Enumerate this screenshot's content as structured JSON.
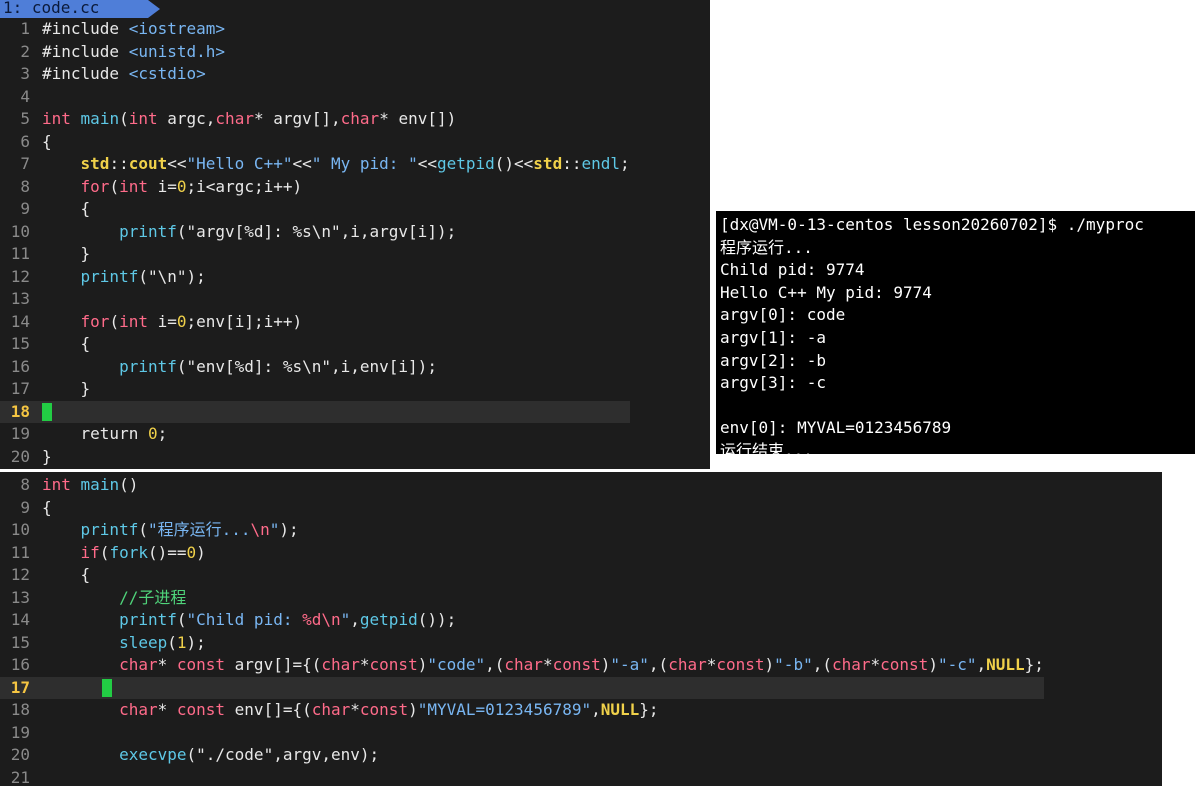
{
  "top_editor": {
    "tab_label": "1: code.cc",
    "cursor_line": 18,
    "lines": [
      {
        "n": "1",
        "tokens": [
          [
            "pp",
            "#include "
          ],
          [
            "inc",
            "<iostream>"
          ]
        ]
      },
      {
        "n": "2",
        "tokens": [
          [
            "pp",
            "#include "
          ],
          [
            "inc",
            "<unistd.h>"
          ]
        ]
      },
      {
        "n": "3",
        "tokens": [
          [
            "pp",
            "#include "
          ],
          [
            "inc",
            "<cstdio>"
          ]
        ]
      },
      {
        "n": "4",
        "tokens": []
      },
      {
        "n": "5",
        "tokens": [
          [
            "kw",
            "int"
          ],
          [
            "plain",
            " "
          ],
          [
            "fn",
            "main"
          ],
          [
            "plain",
            "("
          ],
          [
            "kw",
            "int"
          ],
          [
            "plain",
            " argc,"
          ],
          [
            "kw",
            "char"
          ],
          [
            "plain",
            "* argv[],"
          ],
          [
            "kw",
            "char"
          ],
          [
            "plain",
            "* env[])"
          ]
        ]
      },
      {
        "n": "6",
        "tokens": [
          [
            "plain",
            "{"
          ]
        ]
      },
      {
        "n": "7",
        "tokens": [
          [
            "plain",
            "    "
          ],
          [
            "ns",
            "std"
          ],
          [
            "plain",
            "::"
          ],
          [
            "ns",
            "cout"
          ],
          [
            "plain",
            "<<"
          ],
          [
            "str",
            "\"Hello C++\""
          ],
          [
            "plain",
            "<<"
          ],
          [
            "str",
            "\" My pid: \""
          ],
          [
            "plain",
            "<<"
          ],
          [
            "fn",
            "getpid"
          ],
          [
            "plain",
            "()<<"
          ],
          [
            "ns",
            "std"
          ],
          [
            "plain",
            "::"
          ],
          [
            "fn",
            "endl"
          ],
          [
            "plain",
            ";"
          ]
        ]
      },
      {
        "n": "8",
        "tokens": [
          [
            "plain",
            "    "
          ],
          [
            "kw",
            "for"
          ],
          [
            "plain",
            "("
          ],
          [
            "kw",
            "int"
          ],
          [
            "plain",
            " i="
          ],
          [
            "num",
            "0"
          ],
          [
            "plain",
            ";i<argc;i++)"
          ]
        ]
      },
      {
        "n": "9",
        "tokens": [
          [
            "plain",
            "    {"
          ]
        ]
      },
      {
        "n": "10",
        "tokens": [
          [
            "plain",
            "        "
          ],
          [
            "fn",
            "printf"
          ],
          [
            "plain",
            "(\"argv[%d]: %s\\n\",i,argv[i]);"
          ]
        ]
      },
      {
        "n": "11",
        "tokens": [
          [
            "plain",
            "    }"
          ]
        ]
      },
      {
        "n": "12",
        "tokens": [
          [
            "plain",
            "    "
          ],
          [
            "fn",
            "printf"
          ],
          [
            "plain",
            "(\"\\n\");"
          ]
        ]
      },
      {
        "n": "13",
        "tokens": []
      },
      {
        "n": "14",
        "tokens": [
          [
            "plain",
            "    "
          ],
          [
            "kw",
            "for"
          ],
          [
            "plain",
            "("
          ],
          [
            "kw",
            "int"
          ],
          [
            "plain",
            " i="
          ],
          [
            "num",
            "0"
          ],
          [
            "plain",
            ";env[i];i++)"
          ]
        ]
      },
      {
        "n": "15",
        "tokens": [
          [
            "plain",
            "    {"
          ]
        ]
      },
      {
        "n": "16",
        "tokens": [
          [
            "plain",
            "        "
          ],
          [
            "fn",
            "printf"
          ],
          [
            "plain",
            "(\"env[%d]: %s\\n\",i,env[i]);"
          ]
        ]
      },
      {
        "n": "17",
        "tokens": [
          [
            "plain",
            "    }"
          ]
        ]
      },
      {
        "n": "18",
        "tokens": []
      },
      {
        "n": "19",
        "tokens": [
          [
            "plain",
            "    return "
          ],
          [
            "num",
            "0"
          ],
          [
            "plain",
            ";"
          ]
        ]
      },
      {
        "n": "20",
        "tokens": [
          [
            "plain",
            "}"
          ]
        ]
      }
    ]
  },
  "terminal": {
    "lines": [
      "[dx@VM-0-13-centos lesson20260702]$ ./myproc",
      "程序运行...",
      "Child pid: 9774",
      "Hello C++ My pid: 9774",
      "argv[0]: code",
      "argv[1]: -a",
      "argv[2]: -b",
      "argv[3]: -c",
      "",
      "env[0]: MYVAL=0123456789",
      "运行结束..."
    ]
  },
  "bottom_editor": {
    "cursor_line": 17,
    "lines": [
      {
        "n": "8",
        "tokens": [
          [
            "kw",
            "int"
          ],
          [
            "plain",
            " "
          ],
          [
            "fn",
            "main"
          ],
          [
            "plain",
            "()"
          ]
        ]
      },
      {
        "n": "9",
        "tokens": [
          [
            "plain",
            "{"
          ]
        ]
      },
      {
        "n": "10",
        "tokens": [
          [
            "plain",
            "    "
          ],
          [
            "fn",
            "printf"
          ],
          [
            "plain",
            "("
          ],
          [
            "str",
            "\"程序运行..."
          ],
          [
            "esc",
            "\\n"
          ],
          [
            "str",
            "\""
          ],
          [
            "plain",
            ");"
          ]
        ]
      },
      {
        "n": "11",
        "tokens": [
          [
            "plain",
            "    "
          ],
          [
            "kw",
            "if"
          ],
          [
            "plain",
            "("
          ],
          [
            "fn",
            "fork"
          ],
          [
            "plain",
            "()=="
          ],
          [
            "num",
            "0"
          ],
          [
            "plain",
            ")"
          ]
        ]
      },
      {
        "n": "12",
        "tokens": [
          [
            "plain",
            "    {"
          ]
        ]
      },
      {
        "n": "13",
        "tokens": [
          [
            "plain",
            "        "
          ],
          [
            "com",
            "//子进程"
          ]
        ]
      },
      {
        "n": "14",
        "tokens": [
          [
            "plain",
            "        "
          ],
          [
            "fn",
            "printf"
          ],
          [
            "plain",
            "("
          ],
          [
            "str",
            "\"Child pid: "
          ],
          [
            "esc",
            "%d\\n"
          ],
          [
            "str",
            "\""
          ],
          [
            "plain",
            ","
          ],
          [
            "fn",
            "getpid"
          ],
          [
            "plain",
            "());"
          ]
        ]
      },
      {
        "n": "15",
        "tokens": [
          [
            "plain",
            "        "
          ],
          [
            "fn",
            "sleep"
          ],
          [
            "plain",
            "("
          ],
          [
            "num",
            "1"
          ],
          [
            "plain",
            ");"
          ]
        ]
      },
      {
        "n": "16",
        "tokens": [
          [
            "plain",
            "        "
          ],
          [
            "kw",
            "char"
          ],
          [
            "plain",
            "* "
          ],
          [
            "kw",
            "const"
          ],
          [
            "plain",
            " argv[]={("
          ],
          [
            "kw",
            "char"
          ],
          [
            "plain",
            "*"
          ],
          [
            "kw",
            "const"
          ],
          [
            "plain",
            ")"
          ],
          [
            "str",
            "\"code\""
          ],
          [
            "plain",
            ",("
          ],
          [
            "kw",
            "char"
          ],
          [
            "plain",
            "*"
          ],
          [
            "kw",
            "const"
          ],
          [
            "plain",
            ")"
          ],
          [
            "str",
            "\"-a\""
          ],
          [
            "plain",
            ",("
          ],
          [
            "kw",
            "char"
          ],
          [
            "plain",
            "*"
          ],
          [
            "kw",
            "const"
          ],
          [
            "plain",
            ")"
          ],
          [
            "str",
            "\"-b\""
          ],
          [
            "plain",
            ",("
          ],
          [
            "kw",
            "char"
          ],
          [
            "plain",
            "*"
          ],
          [
            "kw",
            "const"
          ],
          [
            "plain",
            ")"
          ],
          [
            "str",
            "\"-c\""
          ],
          [
            "plain",
            ","
          ],
          [
            "null",
            "NULL"
          ],
          [
            "plain",
            "};"
          ]
        ]
      },
      {
        "n": "17",
        "tokens": []
      },
      {
        "n": "18",
        "tokens": [
          [
            "plain",
            "        "
          ],
          [
            "kw",
            "char"
          ],
          [
            "plain",
            "* "
          ],
          [
            "kw",
            "const"
          ],
          [
            "plain",
            " env[]={("
          ],
          [
            "kw",
            "char"
          ],
          [
            "plain",
            "*"
          ],
          [
            "kw",
            "const"
          ],
          [
            "plain",
            ")"
          ],
          [
            "str",
            "\"MYVAL=0123456789\""
          ],
          [
            "plain",
            ","
          ],
          [
            "null",
            "NULL"
          ],
          [
            "plain",
            "};"
          ]
        ]
      },
      {
        "n": "19",
        "tokens": []
      },
      {
        "n": "20",
        "tokens": [
          [
            "plain",
            "        "
          ],
          [
            "fn",
            "execvpe"
          ],
          [
            "plain",
            "(\"./code\",argv,env);"
          ]
        ]
      },
      {
        "n": "21",
        "tokens": []
      }
    ]
  },
  "colors": {
    "editor_bg": "#1c1c1c",
    "terminal_bg": "#000000",
    "tab_bg": "#4f7ed8",
    "cursor": "#22cc44",
    "line_number": "#8a8a8a",
    "current_line_number": "#f5c542"
  }
}
